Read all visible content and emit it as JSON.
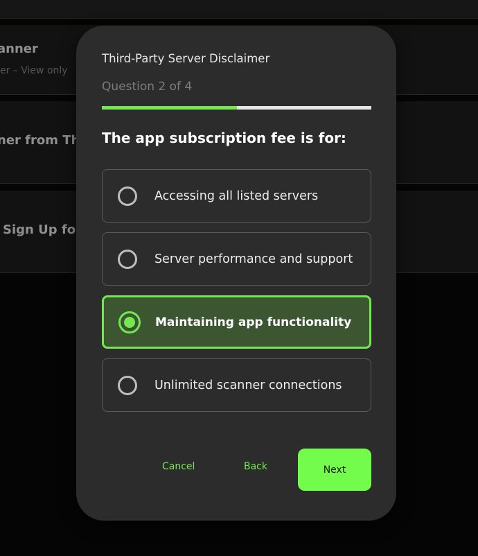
{
  "background": {
    "rows": [
      {
        "title": "anner",
        "subtitle": "er – View only"
      },
      {
        "title": "ner from Thi"
      },
      {
        "title": "Sign Up for"
      }
    ]
  },
  "dialog": {
    "title": "Third-Party Server Disclaimer",
    "progress_text": "Question 2 of 4",
    "progress_fraction": 0.5,
    "question": "The app subscription fee is for:",
    "options": [
      {
        "label": "Accessing all listed servers",
        "selected": false
      },
      {
        "label": "Server performance and support",
        "selected": false
      },
      {
        "label": "Maintaining app functionality",
        "selected": true
      },
      {
        "label": "Unlimited scanner connections",
        "selected": false
      }
    ],
    "buttons": {
      "cancel": "Cancel",
      "back": "Back",
      "next": "Next"
    }
  },
  "colors": {
    "accent": "#74e94f",
    "next_button": "#74fc4c",
    "selected_bg": "#3c5631",
    "dialog_bg": "#2c2c2c"
  }
}
